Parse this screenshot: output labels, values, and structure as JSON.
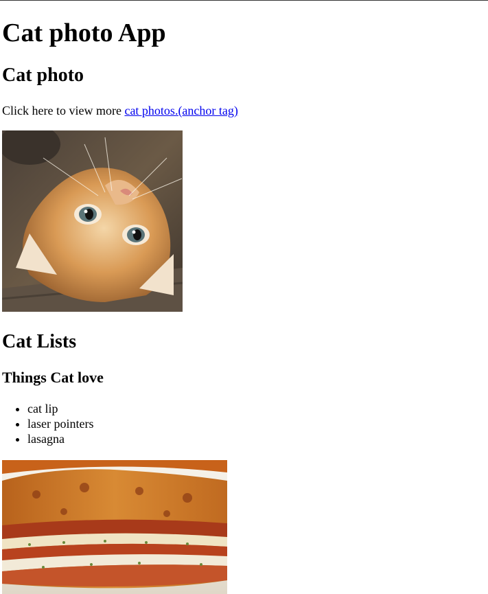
{
  "header": {
    "title": "Cat photo App"
  },
  "main": {
    "section_heading": "Cat photo",
    "intro": {
      "prefix": "Click here to view more ",
      "link_text": "cat photos.(anchor tag)"
    },
    "cat_image": {
      "subject": "kitten lying on its back"
    }
  },
  "lists": {
    "heading": "Cat Lists",
    "subheading": "Things Cat love",
    "items": [
      "cat lip",
      "laser pointers",
      "lasagna"
    ]
  },
  "lasagna_image": {
    "subject": "slice of lasagna on a plate"
  }
}
